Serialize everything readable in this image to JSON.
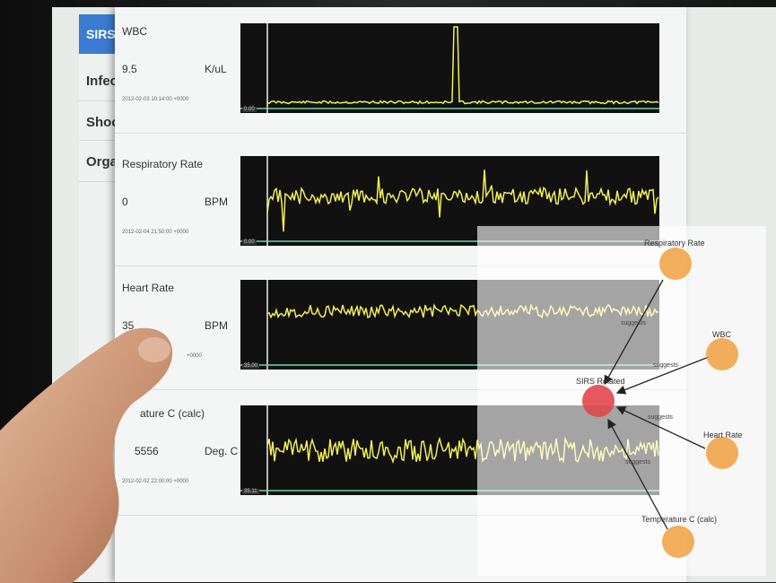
{
  "sidebar": {
    "tab_label": "SIRS",
    "items": [
      {
        "label": "Infec"
      },
      {
        "label": "Shoc"
      },
      {
        "label": "Orga"
      }
    ]
  },
  "rows": [
    {
      "title": "WBC",
      "value": "9.5",
      "unit": "K/uL",
      "timestamp": "2012-02-03 10:14:00 +0000",
      "axis_label": "0.00"
    },
    {
      "title": "Respiratory Rate",
      "value": "0",
      "unit": "BPM",
      "timestamp": "2012-02-04 21:50:00 +0000",
      "axis_label": "0.00"
    },
    {
      "title": "Heart Rate",
      "value": "35",
      "unit": "BPM",
      "timestamp": "+0000",
      "axis_label": "35.00"
    },
    {
      "title": "ature C (calc)",
      "value": "5556",
      "unit": "Deg. C",
      "timestamp": "2012-02-02 22:00:00 +0000",
      "axis_label": "35.11"
    }
  ],
  "graph": {
    "center_label": "SIRS Related",
    "nodes": [
      {
        "label": "Respiratory Rate"
      },
      {
        "label": "WBC"
      },
      {
        "label": "Heart Rate"
      },
      {
        "label": "Temperature C (calc)"
      }
    ],
    "edge_label": "suggests",
    "colors": {
      "center": "#e0474c",
      "node": "#f0a040"
    }
  },
  "colors": {
    "trace": "#f2ee55",
    "baseline": "#6fd6a6",
    "accent": "#3b7bd1"
  }
}
